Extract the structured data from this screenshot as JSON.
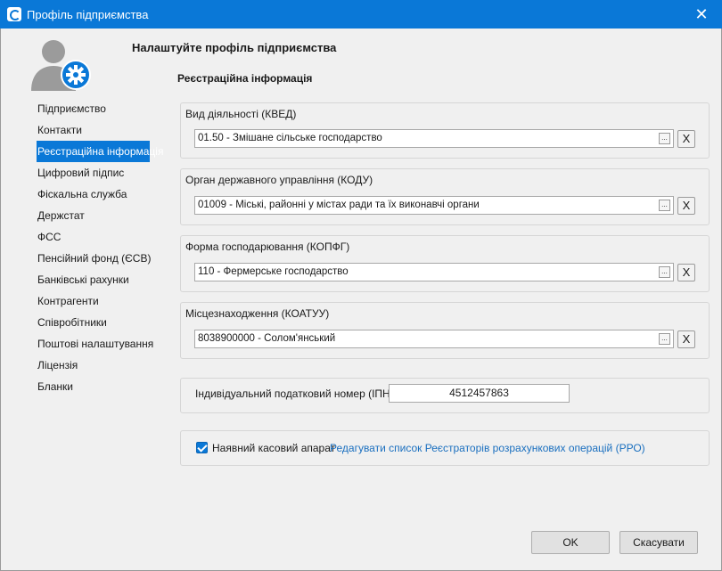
{
  "window": {
    "title": "Профіль підприємства",
    "close_glyph": "✕"
  },
  "header": {
    "title": "Налаштуйте профіль підприємства",
    "section": "Реєстраційна інформація"
  },
  "sidebar": {
    "items": [
      {
        "label": "Підприємство"
      },
      {
        "label": "Контакти"
      },
      {
        "label": "Реєстраційна інформація"
      },
      {
        "label": "Цифровий підпис"
      },
      {
        "label": "Фіскальна служба"
      },
      {
        "label": "Держстат"
      },
      {
        "label": "ФСС"
      },
      {
        "label": "Пенсійний фонд (ЄСВ)"
      },
      {
        "label": "Банківські рахунки"
      },
      {
        "label": "Контрагенти"
      },
      {
        "label": "Співробітники"
      },
      {
        "label": "Поштові налаштування"
      },
      {
        "label": "Ліцензія"
      },
      {
        "label": "Бланки"
      }
    ],
    "active_index": 2
  },
  "fields": {
    "kved": {
      "label": "Вид діяльності (КВЕД)",
      "value": "01.50 - Змішане сільське господарство"
    },
    "kodu": {
      "label": "Орган державного управління (КОДУ)",
      "value": "01009 - Міські, районні у містах ради та їх виконавчі органи"
    },
    "kopfg": {
      "label": "Форма господарювання (КОПФГ)",
      "value": "110 - Фермерське господарство"
    },
    "koatuu": {
      "label": "Місцезнаходження (КОАТУУ)",
      "value": "8038900000 - Солом'янський"
    },
    "browse_glyph": "...",
    "clear_glyph": "X"
  },
  "ipn": {
    "label": "Індивідуальний податковий номер (ІПН):",
    "value": "4512457863"
  },
  "cash_register": {
    "label": "Наявний касовий апарат",
    "checked": true,
    "link": "Редагувати список Реєстраторів розрахункових операцій (РРО)"
  },
  "footer": {
    "ok": "OK",
    "cancel": "Скасувати"
  },
  "colors": {
    "accent": "#0a78d7",
    "link": "#1a6fbf",
    "avatar": "#9b9b9b"
  },
  "icons": [
    "app-icon",
    "close-icon",
    "user-settings-icon",
    "browse-icon",
    "clear-icon",
    "checkbox-icon"
  ]
}
